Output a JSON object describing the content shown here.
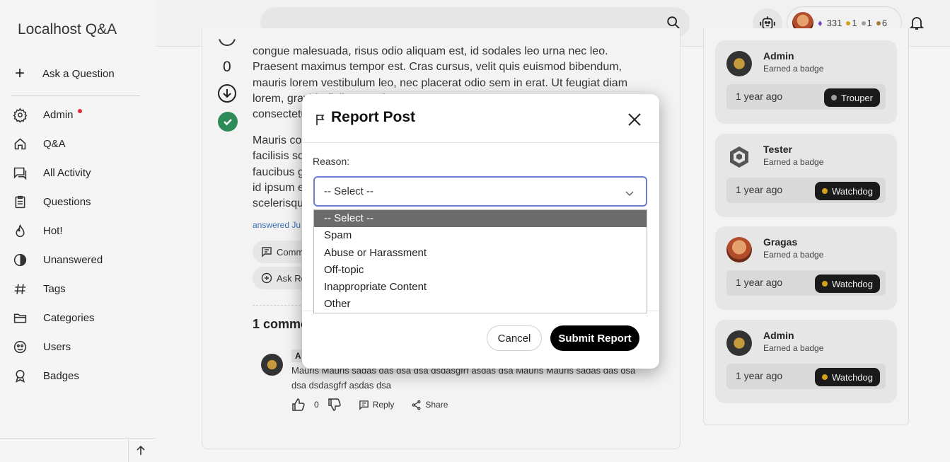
{
  "app": {
    "brand": "Localhost Q&A"
  },
  "sidebar": {
    "ask_label": "Ask a Question",
    "items": [
      {
        "label": "Admin",
        "icon": "gear-icon",
        "has_dot": true
      },
      {
        "label": "Q&A",
        "icon": "home-icon"
      },
      {
        "label": "All Activity",
        "icon": "chat-icon"
      },
      {
        "label": "Questions",
        "icon": "clipboard-icon"
      },
      {
        "label": "Hot!",
        "icon": "flame-icon"
      },
      {
        "label": "Unanswered",
        "icon": "half-circle-icon"
      },
      {
        "label": "Tags",
        "icon": "hash-icon"
      },
      {
        "label": "Categories",
        "icon": "folder-icon"
      },
      {
        "label": "Users",
        "icon": "users-icon"
      },
      {
        "label": "Badges",
        "icon": "badge-icon"
      }
    ]
  },
  "header": {
    "user": {
      "reputation": "331",
      "gold": "1",
      "silver": "1",
      "bronze": "6"
    }
  },
  "colors": {
    "accent": "#6b7fcc",
    "rep": "#7a3ccf",
    "gold": "#d4a017",
    "silver": "#9e9e9e",
    "bronze": "#a57a3c",
    "accepted": "#2e8b57",
    "notify": "#e02b3a"
  },
  "post": {
    "vote_count": "0",
    "para1": "congue malesuada, risus odio aliquam est, id sodales leo urna nec leo. Praesent maximus tempor est. Cras cursus, velit quis euismod bibendum, mauris lorem vestibulum leo, nec placerat odio sem in erat. Ut feugiat diam lorem, gravida finibus turpis susc",
    "para1_tail": "consectetu",
    "para2_lines": [
      "Mauris co",
      "facilisis so",
      "faucibus g",
      "id ipsum e",
      "scelerisqu"
    ],
    "answered": "answered Ju",
    "comment_btn": "Comm",
    "ask_related_btn": "Ask Re",
    "comments_heading": "1 comme",
    "comment": {
      "author_initial": "A",
      "text": "Mauris Mauris sadas das dsa dsa dsdasgfrf asdas dsa Mauris Mauris sadas das dsa dsa dsdasgfrf asdas dsa",
      "likes": "0",
      "reply": "Reply",
      "share": "Share"
    }
  },
  "activity": [
    {
      "name": "Admin",
      "sub": "Earned a badge",
      "time": "1 year ago",
      "badge": "Trouper",
      "badge_color": "#9e9e9e"
    },
    {
      "name": "Tester",
      "sub": "Earned a badge",
      "time": "1 year ago",
      "badge": "Watchdog",
      "badge_color": "#d4a017"
    },
    {
      "name": "Gragas",
      "sub": "Earned a badge",
      "time": "1 year ago",
      "badge": "Watchdog",
      "badge_color": "#d4a017"
    },
    {
      "name": "Admin",
      "sub": "Earned a badge",
      "time": "1 year ago",
      "badge": "Watchdog",
      "badge_color": "#d4a017"
    }
  ],
  "modal": {
    "title": "Report Post",
    "reason_label": "Reason:",
    "selected": "-- Select --",
    "options": [
      "-- Select --",
      "Spam",
      "Abuse or Harassment",
      "Off-topic",
      "Inappropriate Content",
      "Other"
    ],
    "cancel": "Cancel",
    "submit": "Submit Report"
  }
}
